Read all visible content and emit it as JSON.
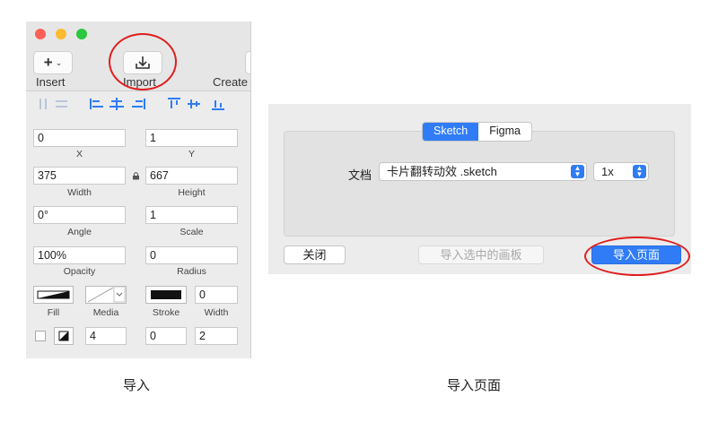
{
  "left": {
    "toolbar": {
      "insert_label": "Insert",
      "insert_btn": "+",
      "import_label": "Import",
      "create_label": "Create"
    },
    "fields": {
      "x": {
        "value": "0",
        "label": "X"
      },
      "y": {
        "value": "1",
        "label": "Y"
      },
      "width": {
        "value": "375",
        "label": "Width"
      },
      "height": {
        "value": "667",
        "label": "Height"
      },
      "angle": {
        "value": "0°",
        "label": "Angle"
      },
      "scale": {
        "value": "1",
        "label": "Scale"
      },
      "opacity": {
        "value": "100%",
        "label": "Opacity"
      },
      "radius": {
        "value": "0",
        "label": "Radius"
      },
      "stroke_width": {
        "value": "0",
        "label": "Width"
      },
      "blur": {
        "value": "4"
      },
      "shadow_x": {
        "value": "0"
      },
      "shadow_y": {
        "value": "2"
      }
    },
    "style_labels": {
      "fill": "Fill",
      "media": "Media",
      "stroke": "Stroke"
    }
  },
  "dialog": {
    "tabs": [
      {
        "label": "Sketch",
        "active": true
      },
      {
        "label": "Figma",
        "active": false
      }
    ],
    "doc_label": "文档",
    "file_select": "卡片翻转动效 .sketch",
    "scale_select": "1x",
    "close_button": "关闭",
    "import_selected_button": "导入选中的画板",
    "import_page_button": "导入页面"
  },
  "captions": {
    "left": "导入",
    "right": "导入页面"
  },
  "colors": {
    "accent": "#2f7cf6",
    "highlight": "#e01e1e"
  }
}
